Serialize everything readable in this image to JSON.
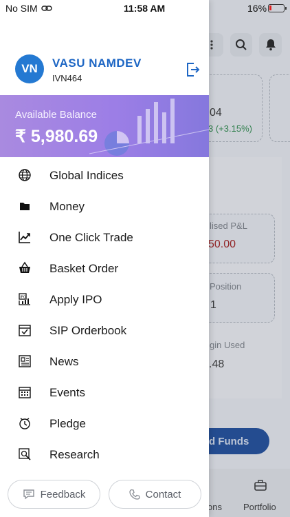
{
  "status_bar": {
    "carrier": "No SIM",
    "time": "11:58 AM",
    "battery": "16%"
  },
  "profile": {
    "initials": "VN",
    "name": "VASU NAMDEV",
    "code": "IVN464"
  },
  "balance": {
    "label": "Available Balance",
    "amount": "₹ 5,980.69"
  },
  "menu": {
    "items": [
      {
        "label": "Global Indices",
        "icon": "globe-icon"
      },
      {
        "label": "Money",
        "icon": "folder-icon"
      },
      {
        "label": "One Click Trade",
        "icon": "trend-chart-icon"
      },
      {
        "label": "Basket Order",
        "icon": "basket-icon"
      },
      {
        "label": "Apply IPO",
        "icon": "ipo-icon"
      },
      {
        "label": "SIP Orderbook",
        "icon": "calendar-check-icon"
      },
      {
        "label": "News",
        "icon": "newspaper-icon"
      },
      {
        "label": "Events",
        "icon": "events-calendar-icon"
      },
      {
        "label": "Pledge",
        "icon": "pledge-icon"
      },
      {
        "label": "Research",
        "icon": "research-icon"
      }
    ]
  },
  "footer": {
    "feedback": "Feedback",
    "contact": "Contact"
  },
  "background": {
    "index_value": "04",
    "index_change": "3  (+3.15%)",
    "realised_label": "lised P&L",
    "realised_value": "50.00",
    "position_label": "Position",
    "position_value": "1",
    "margin_label": "gin Used",
    "margin_value": ".48",
    "add_funds": "d Funds",
    "tab1": "ons",
    "tab2": "Portfolio"
  },
  "colors": {
    "accent": "#1d66c4",
    "avatar": "#2479d2",
    "balance_gradient_start": "#a98ae0",
    "balance_gradient_end": "#8578dd"
  }
}
